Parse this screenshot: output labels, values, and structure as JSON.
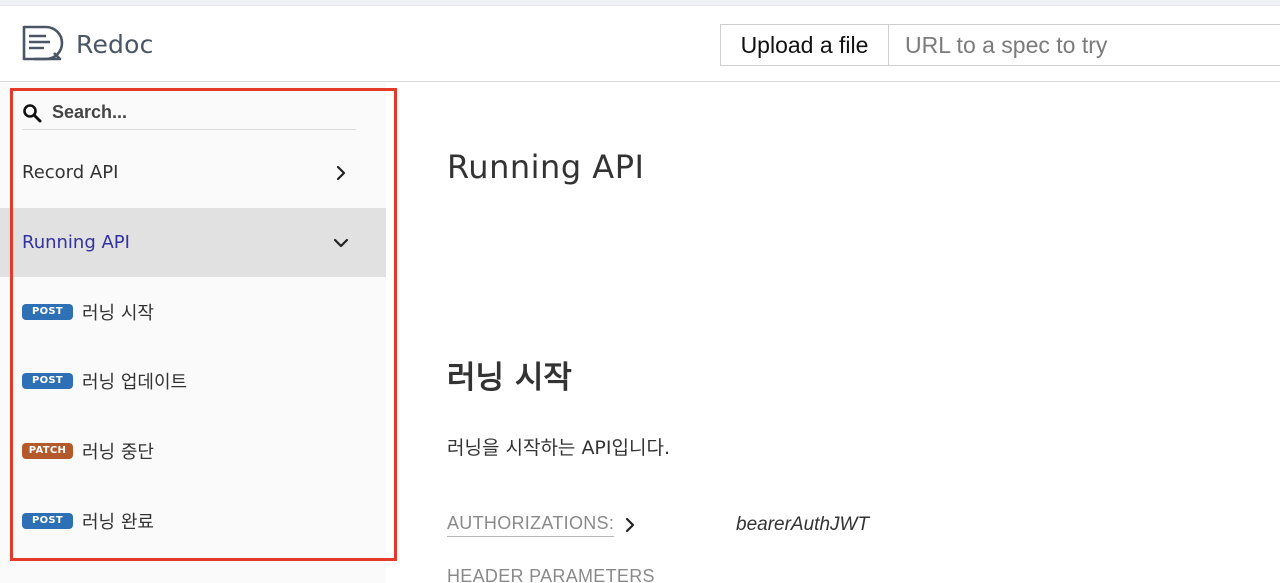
{
  "header": {
    "logo_text": "Redoc",
    "upload_label": "Upload a file",
    "url_placeholder": "URL to a spec to try"
  },
  "sidebar": {
    "search_placeholder": "Search...",
    "groups": [
      {
        "label": "Record API",
        "expanded": false
      },
      {
        "label": "Running API",
        "expanded": true
      }
    ],
    "operations": [
      {
        "method": "POST",
        "label": "러닝 시작"
      },
      {
        "method": "POST",
        "label": "러닝 업데이트"
      },
      {
        "method": "PATCH",
        "label": "러닝 중단"
      },
      {
        "method": "POST",
        "label": "러닝 완료"
      }
    ]
  },
  "main": {
    "section_title": "Running API",
    "operation_title": "러닝 시작",
    "operation_description": "러닝을 시작하는 API입니다.",
    "authorizations_label": "AUTHORIZATIONS:",
    "authorizations_value": "bearerAuthJWT",
    "header_parameters_label": "HEADER PARAMETERS"
  },
  "colors": {
    "active_text": "#32329f",
    "post_badge": "#2d70b5",
    "patch_badge": "#b4592a",
    "highlight_border": "#e53a2a"
  }
}
